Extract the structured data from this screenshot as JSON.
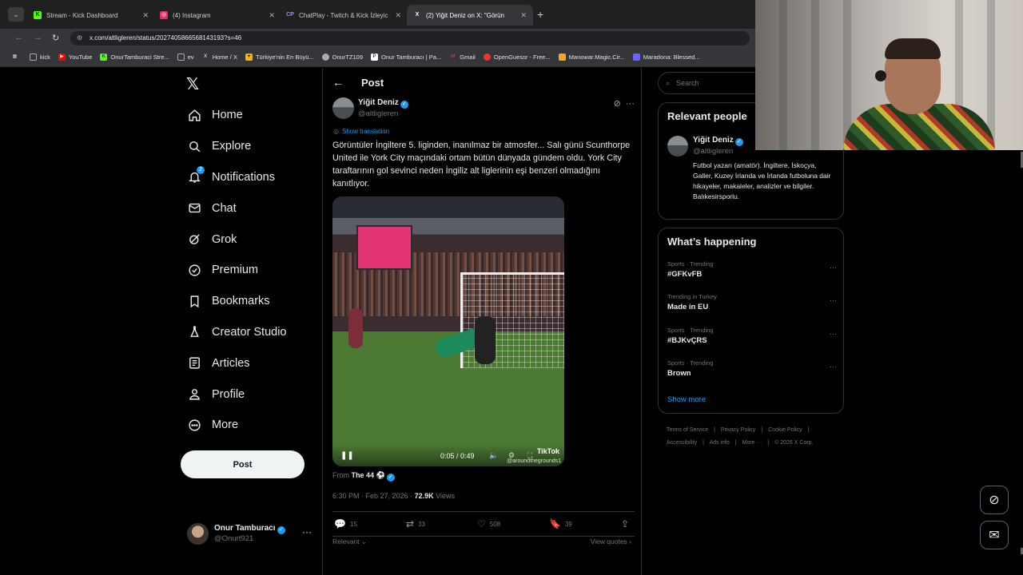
{
  "browser": {
    "tabs": [
      {
        "title": "Stream - Kick Dashboard",
        "favicon": "K",
        "color": "#53fc18"
      },
      {
        "title": "(4) Instagram",
        "favicon": "◎",
        "color": "#e1306c"
      },
      {
        "title": "ChatPlay - Twitch & Kick İzleyic",
        "favicon": "CP",
        "color": "#7b61ff"
      },
      {
        "title": "(2) Yiğit Deniz on X: \"Görün",
        "favicon": "X",
        "color": "#ffffff"
      }
    ],
    "url": "x.com/altligleren/status/2027405866568143193?s=46",
    "bookmarks": [
      {
        "label": "kick",
        "color": "#888"
      },
      {
        "label": "YouTube",
        "color": "#ff0000"
      },
      {
        "label": "OnurTamburaci Stre...",
        "color": "#53fc18"
      },
      {
        "label": "ev",
        "color": "#888"
      },
      {
        "label": "Home / X",
        "color": "#fff"
      },
      {
        "label": "Türkiye'nin En Büyü...",
        "color": "#f5b400"
      },
      {
        "label": "OnurTZ109",
        "color": "#aaa"
      },
      {
        "label": "Onur Tamburacı | Pa...",
        "color": "#fff"
      },
      {
        "label": "Gmail",
        "color": "#ea4335"
      },
      {
        "label": "OpenGuessr - Free...",
        "color": "#e33"
      },
      {
        "label": "Manowar.Magic.Cir...",
        "color": "#f5a623"
      },
      {
        "label": "Maradona: Blessed...",
        "color": "#6c63ff"
      }
    ]
  },
  "sidebar": {
    "logo": "𝕏",
    "items": [
      {
        "label": "Home",
        "icon": "home-icon"
      },
      {
        "label": "Explore",
        "icon": "search-icon"
      },
      {
        "label": "Notifications",
        "icon": "bell-icon",
        "badge": "2"
      },
      {
        "label": "Chat",
        "icon": "mail-icon"
      },
      {
        "label": "Grok",
        "icon": "grok-icon"
      },
      {
        "label": "Premium",
        "icon": "verified-icon"
      },
      {
        "label": "Bookmarks",
        "icon": "bookmark-icon"
      },
      {
        "label": "Creator Studio",
        "icon": "flask-icon"
      },
      {
        "label": "Articles",
        "icon": "article-icon"
      },
      {
        "label": "Profile",
        "icon": "person-icon"
      },
      {
        "label": "More",
        "icon": "more-circle-icon"
      }
    ],
    "post_button": "Post",
    "account": {
      "name": "Onur Tamburacı",
      "handle": "@Onurt921"
    }
  },
  "post": {
    "header_title": "Post",
    "author_name": "Yiğit Deniz",
    "author_handle": "@altligleren",
    "show_translation": "Show translation",
    "text": "Görüntüler İngiltere 5. liginden, inanılmaz bir atmosfer... Salı günü Scunthorpe United ile York City maçındaki ortam bütün dünyada gündem oldu. York City taraftarının gol sevinci neden İngiliz alt liglerinin eşi benzeri olmadığını kanıtlıyor.",
    "video": {
      "time": "0:05 / 0:49",
      "watermark": "TikTok",
      "watermark_handle": "@aroundthegrounds1"
    },
    "from_prefix": "From",
    "from_account": "The 44 ⚽",
    "timestamp": "6:30 PM · Feb 27, 2026 · ",
    "views_count": "72.9K",
    "views_label": " Views",
    "stats": {
      "replies": "15",
      "reposts": "33",
      "likes": "508",
      "bookmarks": "39"
    },
    "relevant_label": "Relevant ⌄",
    "view_quotes": "View quotes ›"
  },
  "right": {
    "search_placeholder": "Search",
    "relevant_people_title": "Relevant people",
    "person": {
      "name": "Yiğit Deniz",
      "handle": "@altligleren",
      "bio": "Futbol yazarı (amatör). İngiltere, İskoçya, Galler, Kuzey İrlanda ve İrlanda futboluna dair hikayeler, makaleler, analizler ve bilgiler. Balıkesirsporlu."
    },
    "whats_happening_title": "What’s happening",
    "trends": [
      {
        "category": "Sports · Trending",
        "name": "#GFKvFB"
      },
      {
        "category": "Trending in Turkey",
        "name": "Made in EU"
      },
      {
        "category": "Sports · Trending",
        "name": "#BJKvÇRS"
      },
      {
        "category": "Sports · Trending",
        "name": "Brown"
      }
    ],
    "show_more": "Show more",
    "footer": [
      "Terms of Service",
      "|",
      "Privacy Policy",
      "|",
      "Cookie Policy",
      "|",
      "Accessibility",
      "|",
      "Ads info",
      "|",
      "More ···",
      "|",
      "© 2026 X Corp."
    ]
  },
  "colors": {
    "accent": "#1d9bf0",
    "background": "#000000",
    "border": "#2f3336",
    "muted": "#71767b"
  }
}
